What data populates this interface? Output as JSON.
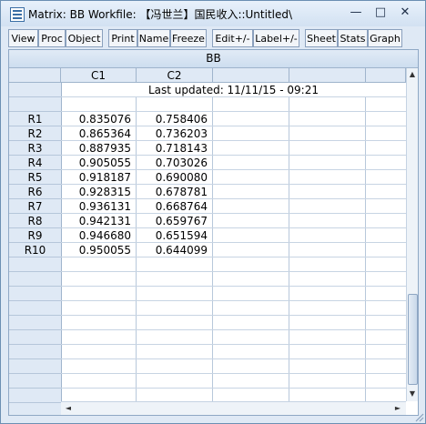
{
  "window": {
    "title": "Matrix: BB   Workfile: 【冯世兰】国民收入::Untitled\\",
    "controls": {
      "minimize": "—",
      "maximize": "□",
      "close": "✕"
    }
  },
  "toolbar": {
    "buttons": [
      "View",
      "Proc",
      "Object",
      "Print",
      "Name",
      "Freeze",
      "Edit+/-",
      "Label+/-",
      "Sheet",
      "Stats",
      "Graph"
    ]
  },
  "matrix": {
    "name": "BB",
    "columns": [
      "C1",
      "C2"
    ],
    "last_updated": "Last updated: 11/11/15 - 09:21",
    "rows": [
      {
        "label": "R1",
        "c1": "0.835076",
        "c2": "0.758406"
      },
      {
        "label": "R2",
        "c1": "0.865364",
        "c2": "0.736203"
      },
      {
        "label": "R3",
        "c1": "0.887935",
        "c2": "0.718143"
      },
      {
        "label": "R4",
        "c1": "0.905055",
        "c2": "0.703026"
      },
      {
        "label": "R5",
        "c1": "0.918187",
        "c2": "0.690080"
      },
      {
        "label": "R6",
        "c1": "0.928315",
        "c2": "0.678781"
      },
      {
        "label": "R7",
        "c1": "0.936131",
        "c2": "0.668764"
      },
      {
        "label": "R8",
        "c1": "0.942131",
        "c2": "0.659767"
      },
      {
        "label": "R9",
        "c1": "0.946680",
        "c2": "0.651594"
      },
      {
        "label": "R10",
        "c1": "0.950055",
        "c2": "0.644099"
      }
    ]
  },
  "scrollbars": {
    "up": "▲",
    "down": "▼",
    "left": "◄",
    "right": "►"
  }
}
